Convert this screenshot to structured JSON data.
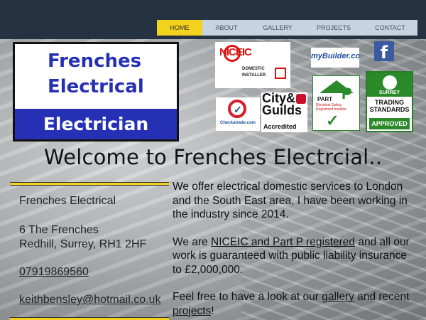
{
  "nav": {
    "items": [
      {
        "label": "HOME",
        "active": true
      },
      {
        "label": "ABOUT"
      },
      {
        "label": "GALLERY"
      },
      {
        "label": "PROJECTS"
      },
      {
        "label": "CONTACT"
      }
    ]
  },
  "logo": {
    "line1": "Frenches",
    "line2": "Electrical",
    "band": "Electrician"
  },
  "badges": {
    "niceic": {
      "mark": "NICEIC",
      "sub1": "DOMESTIC",
      "sub2": "INSTALLER"
    },
    "mybuilder": "myBuilder.com",
    "facebook": "f",
    "checkatrade": "Checkatrade.com",
    "cityguilds": {
      "line1": "City&",
      "line2": "Guilds",
      "line3": "Accredited"
    },
    "partp": {
      "label": "PART",
      "letter": "P",
      "sub": "Electrical Safety Registered Installer"
    },
    "surrey": {
      "name": "SURREY",
      "ts1": "TRADING",
      "ts2": "STANDARDS",
      "approved": "APPROVED"
    }
  },
  "welcome": "Welcome to Frenches Electrcial..",
  "contact": {
    "name": "Frenches Electrical",
    "address1": "6 The Frenches",
    "address2": "Redhill, Surrey, RH1 2HF",
    "phone": "07919869560",
    "email": "keithbensley@hotmail.co.uk"
  },
  "intro": {
    "p1": "We offer electrical domestic services to London and the South East area, I have been working in the industry since 2014.",
    "p2_a": "We are ",
    "p2_link": "NICEIC and Part P registered",
    "p2_b": " and all our work is guaranteed with public liability insurance to £2,000,000.",
    "p3_a": "Feel free to have a look at our ",
    "p3_link1": "gallery",
    "p3_b": " and recent ",
    "p3_link2": "projects",
    "p3_c": "!"
  },
  "colors": {
    "header_bg": "#243241",
    "nav_bg": "#c6d3e0",
    "nav_active": "#f2d21c",
    "brand_blue": "#2530b5"
  }
}
